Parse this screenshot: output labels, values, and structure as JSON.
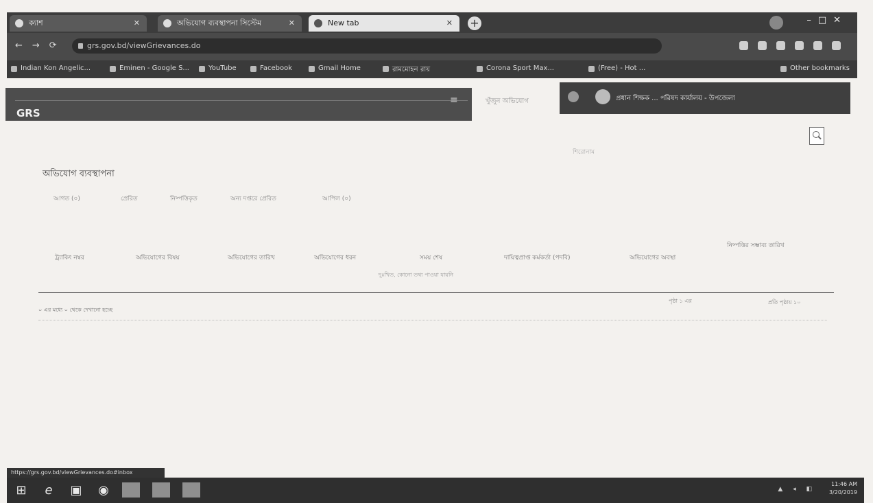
{
  "browser": {
    "tabs": [
      {
        "label": "ক্যাশ"
      },
      {
        "label": "অভিযোগ ব্যবস্থাপনা সিস্টেম"
      },
      {
        "label": "New tab"
      }
    ],
    "new_tab_label": "+",
    "url": "grs.gov.bd/viewGrievances.do",
    "bookmarks": [
      "Indian Kon Angelic...",
      "Eminen - Google S...",
      "YouTube",
      "Facebook",
      "Gmail Home",
      "রামমোহন রায়",
      "Corona Sport Max...",
      "(Free) - Hot ...",
      "Other bookmarks"
    ]
  },
  "app": {
    "brand": "GRS",
    "search_hint": "খুঁজুন অভিযোগ",
    "user_name": "প্রধান শিক্ষক ... পরিষদ কার্যালয় - উপজেলা",
    "top_hint": "শিরোনাম",
    "page_title": "অভিযোগ ব্যবস্থাপনা",
    "tabs": [
      "আগত (০)",
      "প্রেরিত",
      "নিষ্পত্তিকৃত",
      "অন্য দপ্তরে প্রেরিত",
      "আপিল (০)"
    ],
    "table_headers": [
      "ট্র্যাকিং নম্বর",
      "অভিযোগের বিষয়",
      "অভিযোগের তারিখ",
      "অভিযোগের ধরন",
      "সময় শেষ",
      "দায়িত্বপ্রাপ্ত কর্মকর্তা (পদবি)",
      "অভিযোগের অবস্থা",
      "নিষ্পত্তির সম্ভাব্য তারিখ"
    ],
    "empty_message": "দুঃখিত, কোনো তথ্য পাওয়া যায়নি",
    "footer_left": "০ এর মধ্যে ০ থেকে দেখানো হচ্ছে",
    "footer_page": "পৃষ্ঠা ১ এর",
    "footer_right": "প্রতি পৃষ্ঠায় ১০"
  },
  "status_bar_url": "https://grs.gov.bd/viewGrievances.do#inbox",
  "taskbar": {
    "time": "11:46 AM",
    "date": "3/20/2019"
  }
}
